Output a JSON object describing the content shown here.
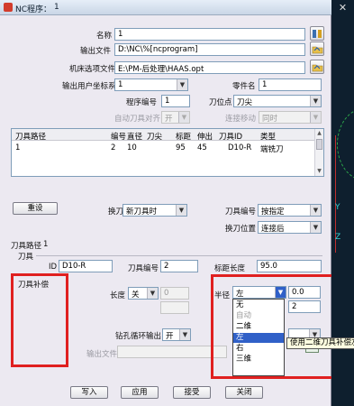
{
  "window": {
    "title": "NC程序：",
    "number": "1"
  },
  "program": {
    "name_label": "名称",
    "name_value": "1",
    "output_label": "输出文件",
    "output_value": "D:\\NC\\%[ncprogram]",
    "machine_label": "机床选项文件",
    "machine_value": "E:\\PM-后处理\\HAAS.opt",
    "ucs_label": "输出用户坐标系",
    "ucs_value": "1",
    "part_label": "零件名",
    "part_value": "1",
    "prog_no_label": "程序编号",
    "prog_no_value": "1",
    "tool_point_label": "刀位点",
    "tool_point_value": "刀尖",
    "auto_align_label": "自动刀具对齐",
    "auto_align_value": "开",
    "link_label": "连接移动",
    "link_value": "同时"
  },
  "table": {
    "headers": [
      "刀具路径",
      "编号",
      "直径",
      "刀尖",
      "标距",
      "伸出",
      "刀具ID",
      "类型"
    ],
    "rows": [
      [
        "1",
        "2",
        "10",
        "",
        "95",
        "45",
        "D10-R",
        "端铣刀"
      ]
    ]
  },
  "mid": {
    "reset_button": "重设",
    "tool_change_label": "换刀",
    "tool_change_value": "新刀具时",
    "tool_no_label": "刀具编号",
    "tool_no_value": "按指定",
    "tool_change_pos_label": "换刀位置",
    "tool_change_pos_value": "连接后"
  },
  "tool_section": {
    "path_label": "刀具路径",
    "path_value": "1",
    "tool_group_label": "刀具",
    "id_label": "ID",
    "id_value": "D10-R",
    "tool_no_label": "刀具编号",
    "tool_no_value": "2",
    "gauge_label": "标距长度",
    "gauge_value": "95.0"
  },
  "comp": {
    "title": "刀具补偿",
    "length_label": "长度",
    "length_value": "关",
    "length_num": "0",
    "radius_label": "半径",
    "radius_value": "左",
    "radius_num": "0.0",
    "radius_num2": "2"
  },
  "drill": {
    "label": "钻孔循环输出",
    "value": "开",
    "output_label": "输出文件"
  },
  "dropdown_options": [
    {
      "text": "无",
      "state": "normal"
    },
    {
      "text": "自动",
      "state": "disabled"
    },
    {
      "text": "二维",
      "state": "normal"
    },
    {
      "text": "左",
      "state": "selected"
    },
    {
      "text": "右",
      "state": "normal"
    },
    {
      "text": "三维",
      "state": "normal"
    }
  ],
  "tooltip": "使用二维刀具补偿左",
  "buttons": {
    "write": "写入",
    "apply": "应用",
    "accept": "接受",
    "close": "关闭"
  },
  "cad": {
    "close": "✕",
    "y_label": "Y",
    "z_label": "Z"
  },
  "colors": {
    "highlight": "#e02020",
    "selection": "#3060c8"
  }
}
